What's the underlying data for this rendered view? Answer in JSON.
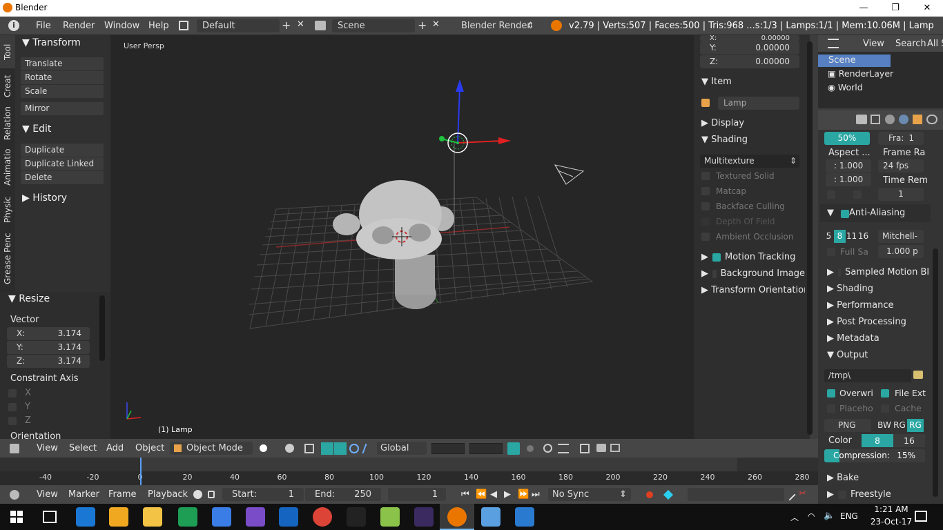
{
  "window": {
    "title": "Blender",
    "minimize": "—",
    "maximize": "❐",
    "close": "✕"
  },
  "info": {
    "menus": [
      "File",
      "Render",
      "Window",
      "Help"
    ],
    "screen_layout": "Default",
    "scene": "Scene",
    "engine": "Blender Render",
    "stats": "v2.79 | Verts:507 | Faces:500 | Tris:968 ...s:1/3 | Lamps:1/1 | Mem:10.06M | Lamp"
  },
  "tool_tabs": [
    "Tool",
    "Creat",
    "Relation",
    "Animatio",
    "Physic",
    "Grease Penc"
  ],
  "toolshelf": {
    "transform": {
      "title": "Transform",
      "buttons": [
        "Translate",
        "Rotate",
        "Scale"
      ],
      "mirror": "Mirror"
    },
    "edit": {
      "title": "Edit",
      "buttons": [
        "Duplicate",
        "Duplicate Linked",
        "Delete"
      ]
    },
    "history": "History"
  },
  "operator": {
    "title": "Resize",
    "vector_label": "Vector",
    "x_label": "X:",
    "x": "3.174",
    "y_label": "Y:",
    "y": "3.174",
    "z_label": "Z:",
    "z": "3.174",
    "constraint_label": "Constraint Axis",
    "axes": [
      "X",
      "Y",
      "Z"
    ],
    "orientation_label": "Orientation"
  },
  "viewport": {
    "view_name": "User Persp",
    "object_label": "(1) Lamp"
  },
  "npanel": {
    "x_label": "X:",
    "x_value": "0.00000",
    "y_label": "Y:",
    "y_value": "0.00000",
    "z_label": "Z:",
    "z_value": "0.00000",
    "item_title": "Item",
    "item_name": "Lamp",
    "display_title": "Display",
    "shading_title": "Shading",
    "shading_mode": "Multitexture",
    "shading_options": [
      "Textured Solid",
      "Matcap",
      "Backface Culling",
      "Depth Of Field",
      "Ambient Occlusion"
    ],
    "motion_tracking": "Motion Tracking",
    "background_images": "Background Image",
    "transform_orientations": "Transform Orientation"
  },
  "outliner": {
    "menus": [
      "View",
      "Search",
      "All S"
    ],
    "items": [
      "Scene",
      "RenderLayer",
      "World"
    ]
  },
  "props": {
    "resolution_pct": "50%",
    "frame_label": "Fra:",
    "frame_value": "1",
    "aspect_label": "Aspect ...",
    "frame_rate_label": "Frame Ra",
    "aspect_x": ": 1.000",
    "fps": "24 fps",
    "aspect_y": ": 1.000",
    "time_remap_label": "Time Rem",
    "time_remap_value": "1",
    "anti_aliasing": "Anti-Aliasing",
    "aa_samples": [
      "5",
      "8",
      "11",
      "16"
    ],
    "aa_filter": "Mitchell-",
    "full_sample": "Full Sa",
    "filter_size": "1.000 p",
    "panels": [
      "Sampled Motion Bl",
      "Shading",
      "Performance",
      "Post Processing",
      "Metadata"
    ],
    "output": "Output",
    "output_path": "/tmp\\",
    "overwrite": "Overwri",
    "file_ext": "File Ext",
    "placeholders": "Placeho",
    "cache": "Cache",
    "format": "PNG",
    "color_modes": [
      "BW",
      "RG",
      "RG"
    ],
    "color_label": "Color",
    "color_depth": [
      "8",
      "16"
    ],
    "compression_label": "Compression:",
    "compression_value": "15%",
    "compression_pct": 15,
    "bake": "Bake",
    "freestyle": "Freestyle"
  },
  "view3d_header": {
    "menus": [
      "View",
      "Select",
      "Add",
      "Object"
    ],
    "mode": "Object Mode",
    "orientation": "Global"
  },
  "timeline": {
    "ticks": [
      "-40",
      "-20",
      "0",
      "20",
      "40",
      "60",
      "80",
      "100",
      "120",
      "140",
      "160",
      "180",
      "200",
      "220",
      "240",
      "260",
      "280"
    ],
    "current_frame": 0
  },
  "timeline_header": {
    "menus": [
      "View",
      "Marker",
      "Frame",
      "Playback"
    ],
    "start_label": "Start:",
    "start": "1",
    "end_label": "End:",
    "end": "250",
    "current": "1",
    "sync": "No Sync"
  },
  "taskbar": {
    "time": "1:21 AM",
    "date": "23-Oct-17",
    "lang": "ENG"
  },
  "colors": {
    "accent": "#2aa7a3",
    "selection": "#5680c2",
    "header": "#464646"
  }
}
